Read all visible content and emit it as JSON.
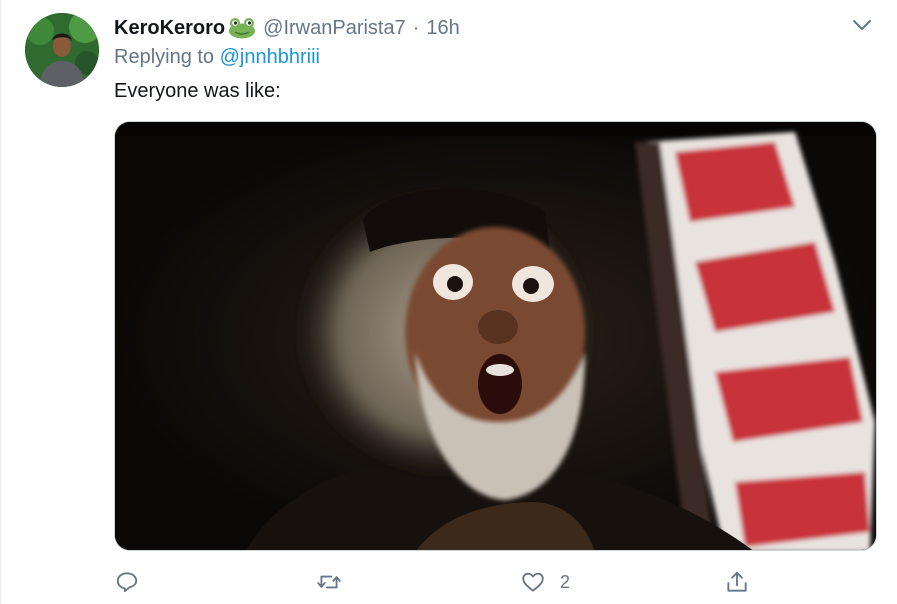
{
  "tweet": {
    "display_name": "KeroKeroro",
    "name_emoji": "frog-emoji",
    "handle": "@IrwanParista7",
    "separator": "·",
    "time": "16h",
    "replying_prefix": "Replying to",
    "replying_to": "@jnnhbhriii",
    "text": "Everyone was like:",
    "media_icon": "meme-image"
  },
  "actions": {
    "reply_icon": "reply-icon",
    "retweet_icon": "retweet-icon",
    "like_icon": "heart-icon",
    "like_count": "2",
    "share_icon": "share-icon"
  },
  "colors": {
    "text_primary": "#14171a",
    "text_secondary": "#657786",
    "link": "#1b95e0",
    "border": "#ccd6dd"
  }
}
